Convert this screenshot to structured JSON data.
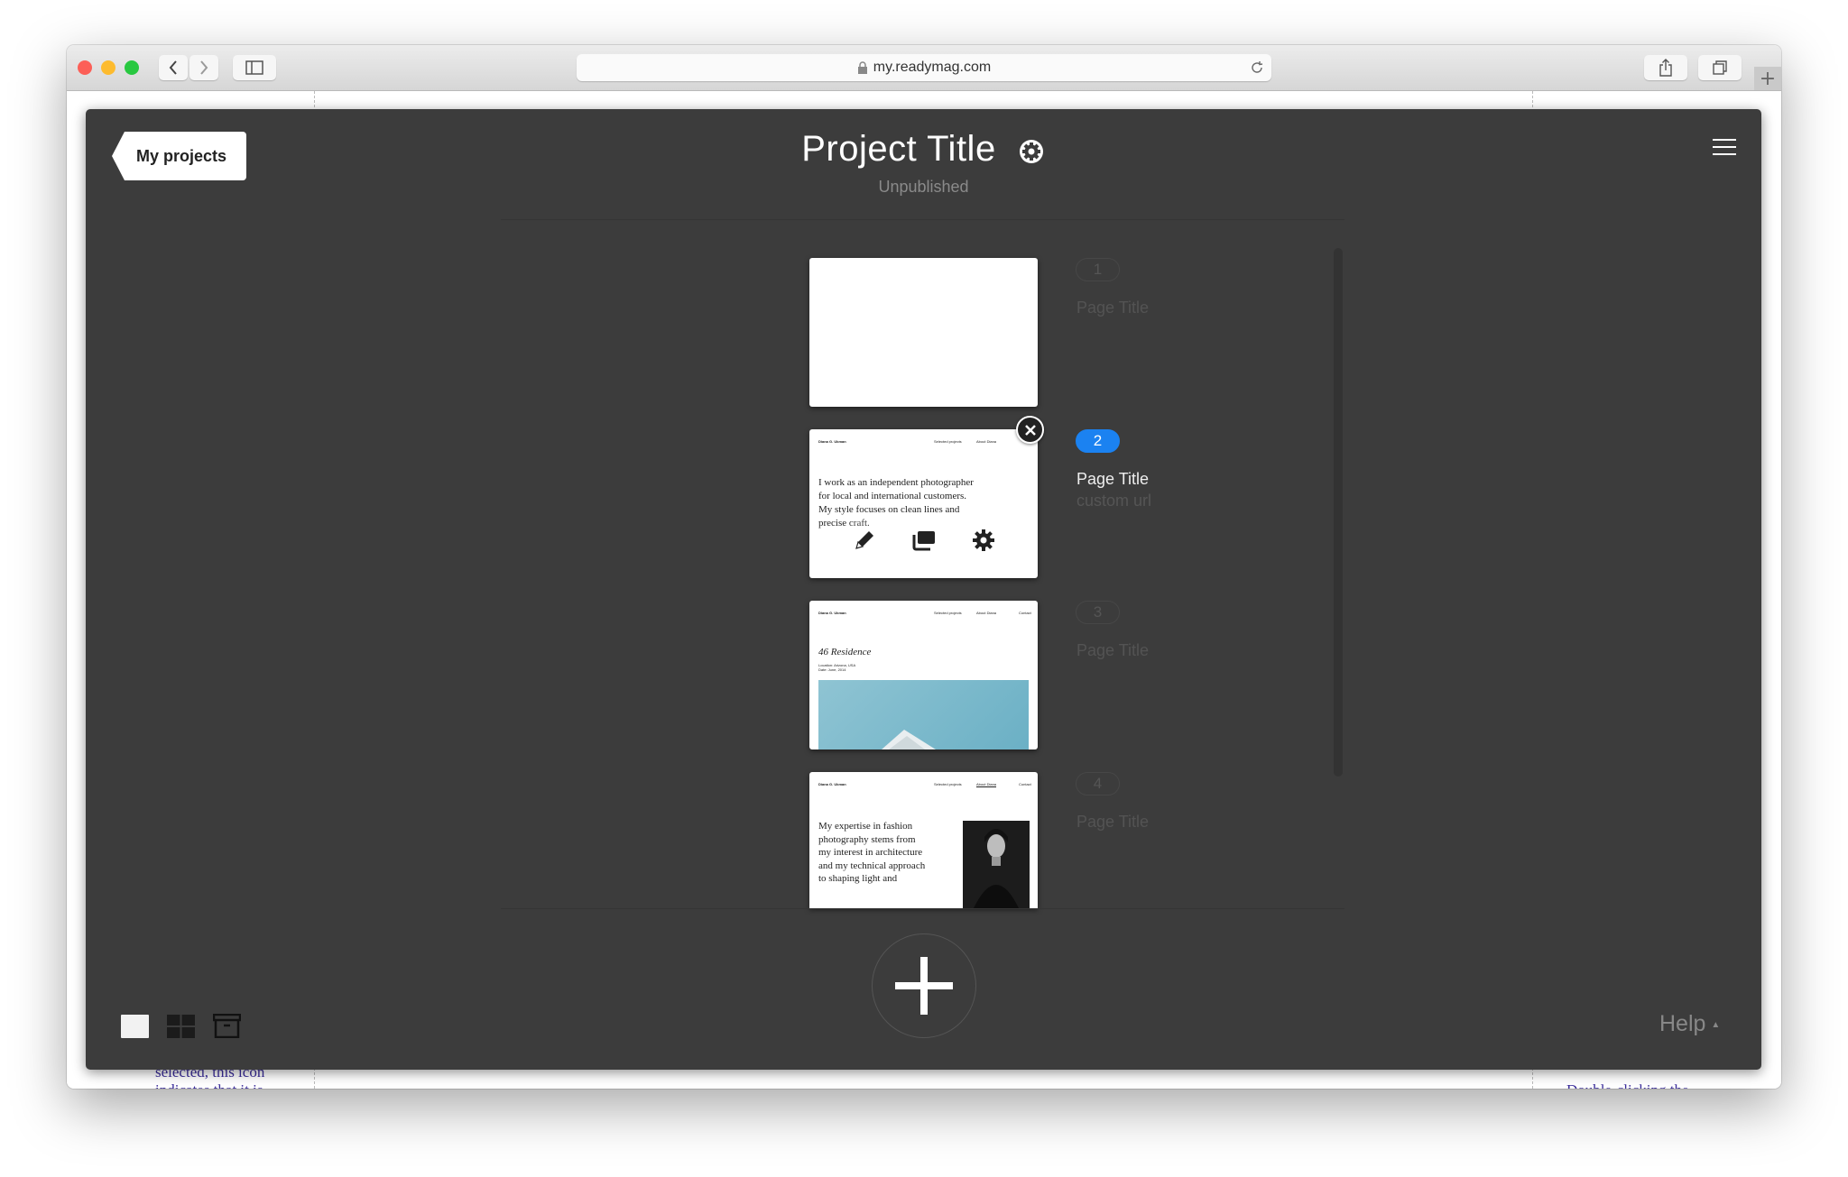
{
  "browser": {
    "url": "my.readymag.com",
    "icons": {
      "back": "chevron-left-icon",
      "forward": "chevron-right-icon",
      "sidebar": "sidebar-icon",
      "lock": "lock-icon",
      "reload": "reload-icon",
      "share": "share-icon",
      "tabs": "tabs-icon",
      "new_tab": "plus-icon"
    },
    "new_tab_label": "+"
  },
  "header": {
    "back_button": "My projects",
    "project_title": "Project Title",
    "status": "Unpublished"
  },
  "pages": [
    {
      "number": "1",
      "title": "Page Title",
      "url": "",
      "active": false
    },
    {
      "number": "2",
      "title": "Page Title",
      "url": "custom url",
      "active": true
    },
    {
      "number": "3",
      "title": "Page Title",
      "url": "",
      "active": false
    },
    {
      "number": "4",
      "title": "Page Title",
      "url": "",
      "active": false
    }
  ],
  "thumbnails": {
    "site_name": "Diana G. Ukman",
    "nav": [
      "Selected projects",
      "About Diana",
      "Contact"
    ],
    "page2_text": "I work as an independent photographer for local and international customers. My style focuses on clean lines and precise craft.",
    "page3_heading": "46 Residence",
    "page3_meta": [
      "Location: Arizona, USA",
      "Date: June, 2014"
    ],
    "page4_text": "My expertise in fashion photography stems from my interest in architecture and my technical approach to shaping light and"
  },
  "footer": {
    "help_label": "Help",
    "help_caret": "▲"
  },
  "background_text": {
    "left": [
      "selected, this icon",
      "indicates that it is"
    ],
    "right": "Double-clicking the"
  },
  "colors": {
    "panel": "#3c3c3c",
    "accent": "#1b82f1"
  }
}
